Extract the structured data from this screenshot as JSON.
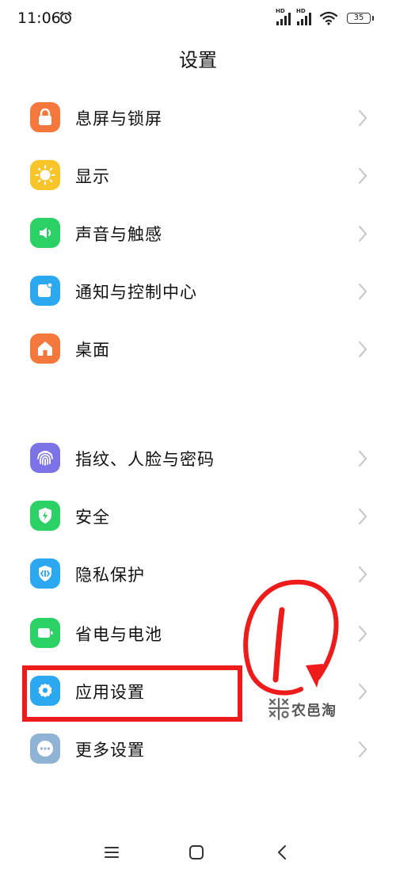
{
  "status_bar": {
    "time": "11:06",
    "icons": [
      "alarm-icon",
      "signal-hd-1-icon",
      "signal-hd-2-icon",
      "wifi-icon",
      "battery-icon"
    ],
    "network_labels": [
      "HD",
      "HD"
    ],
    "battery_level": "35"
  },
  "page": {
    "title": "设置"
  },
  "settings_groups": [
    {
      "items": [
        {
          "label": "息屏与锁屏",
          "icon": "lock-icon",
          "color": "#F4773B"
        },
        {
          "label": "显示",
          "icon": "sun-icon",
          "color": "#F7C52A"
        },
        {
          "label": "声音与触感",
          "icon": "speaker-icon",
          "color": "#2BD165"
        },
        {
          "label": "通知与控制中心",
          "icon": "notification-icon",
          "color": "#2BA8F0"
        },
        {
          "label": "桌面",
          "icon": "home-icon",
          "color": "#F4773B"
        }
      ]
    },
    {
      "items": [
        {
          "label": "指纹、人脸与密码",
          "icon": "fingerprint-icon",
          "color": "#7C74E6"
        },
        {
          "label": "安全",
          "icon": "shield-icon",
          "color": "#2BD165"
        },
        {
          "label": "隐私保护",
          "icon": "privacy-icon",
          "color": "#2BA8F0"
        },
        {
          "label": "省电与电池",
          "icon": "battery-saver-icon",
          "color": "#2BD165"
        },
        {
          "label": "应用设置",
          "icon": "app-gear-icon",
          "color": "#2BA8F0"
        },
        {
          "label": "更多设置",
          "icon": "more-dots-icon",
          "color": "#8FB3D4"
        }
      ]
    }
  ],
  "annotation": {
    "color": "#EE1B1B",
    "highlighted_item": "应用设置",
    "circled_mark": "1"
  },
  "watermark": {
    "text": "农邑淘"
  },
  "navigation_bar": {
    "icons": [
      "menu-icon",
      "home-square-icon",
      "back-icon"
    ]
  }
}
